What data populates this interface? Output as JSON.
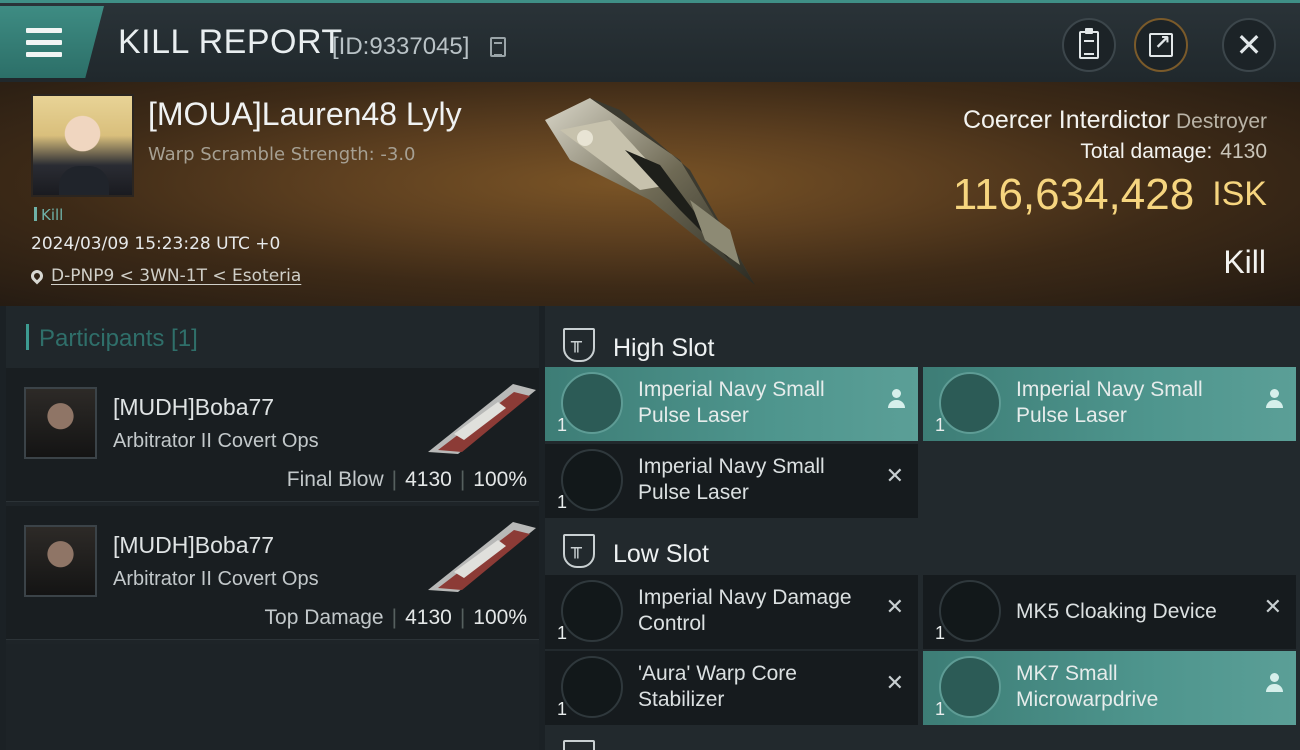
{
  "header": {
    "title": "KILL REPORT",
    "report_id": "[ID:9337045]"
  },
  "victim": {
    "name": "[MOUA]Lauren48 Lyly",
    "warp_scramble": "Warp Scramble Strength: -3.0",
    "tag": "Kill",
    "time": "2024/03/09 15:23:28 UTC +0",
    "location": "D-PNP9 < 3WN-1T < Esoteria"
  },
  "ship": {
    "name": "Coercer Interdictor",
    "class": "Destroyer",
    "total_damage_label": "Total damage:",
    "total_damage": "4130",
    "isk_value": "116,634,428",
    "isk_unit": "ISK",
    "result": "Kill"
  },
  "participants": {
    "title": "Participants [1]",
    "items": [
      {
        "name": "[MUDH]Boba77",
        "ship": "Arbitrator II Covert Ops",
        "role": "Final Blow",
        "damage": "4130",
        "percent": "100%"
      },
      {
        "name": "[MUDH]Boba77",
        "ship": "Arbitrator II Covert Ops",
        "role": "Top Damage",
        "damage": "4130",
        "percent": "100%"
      }
    ]
  },
  "fitting": {
    "high_slot": {
      "title": "High Slot",
      "modules": [
        {
          "name": "Imperial Navy Small Pulse Laser",
          "qty": "1",
          "state": "fitted"
        },
        {
          "name": "Imperial Navy Small Pulse Laser",
          "qty": "1",
          "state": "fitted"
        },
        {
          "name": "Imperial Navy Small Pulse Laser",
          "qty": "1",
          "state": "destroyed"
        }
      ]
    },
    "low_slot": {
      "title": "Low Slot",
      "modules": [
        {
          "name": "Imperial Navy Damage Control",
          "qty": "1",
          "state": "destroyed"
        },
        {
          "name": "MK5 Cloaking Device",
          "qty": "1",
          "state": "destroyed"
        },
        {
          "name": "'Aura' Warp Core Stabilizer",
          "qty": "1",
          "state": "destroyed"
        },
        {
          "name": "MK7 Small Microwarpdrive",
          "qty": "1",
          "state": "fitted"
        }
      ]
    }
  },
  "colors": {
    "accent_teal": "#3d9b91",
    "isk_gold": "#f6d57f",
    "fitted_bg": "#4e958d"
  },
  "icons": {
    "status_fitted": "person-icon",
    "status_destroyed": "close-icon"
  }
}
